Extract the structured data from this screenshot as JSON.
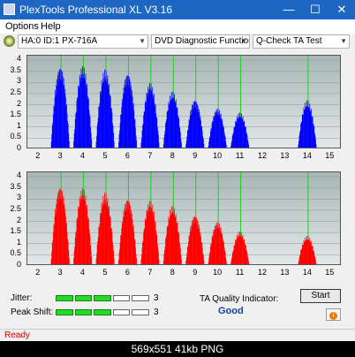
{
  "app": {
    "title": "PlexTools Professional XL V3.16"
  },
  "window_buttons": {
    "minimize": "—",
    "maximize": "☐",
    "close": "✕"
  },
  "menu": {
    "items": [
      {
        "label": "Options"
      },
      {
        "label": "Help"
      }
    ]
  },
  "toolbar": {
    "drive": "HA:0 ID:1  PX-716A",
    "function": "DVD Diagnostic Functions",
    "test": "Q-Check TA Test"
  },
  "chart_data": [
    {
      "type": "bar",
      "colour": "#0000ff",
      "xlim": [
        1.5,
        15.5
      ],
      "ylim": [
        0,
        4.2
      ],
      "yticks": [
        "4",
        "3.5",
        "3",
        "2.5",
        "2",
        "1.5",
        "1",
        "0.5",
        "0"
      ],
      "xticks": [
        "2",
        "3",
        "4",
        "5",
        "6",
        "7",
        "8",
        "9",
        "10",
        "11",
        "12",
        "13",
        "14",
        "15"
      ],
      "green_lines": [
        3,
        4,
        5,
        6,
        7,
        8,
        9,
        10,
        11,
        14
      ],
      "peaks": [
        {
          "center": 2.95,
          "height": 3.75
        },
        {
          "center": 3.95,
          "height": 3.75
        },
        {
          "center": 4.95,
          "height": 3.6
        },
        {
          "center": 5.95,
          "height": 3.45
        },
        {
          "center": 6.95,
          "height": 3.0
        },
        {
          "center": 7.95,
          "height": 2.6
        },
        {
          "center": 8.95,
          "height": 2.25
        },
        {
          "center": 9.95,
          "height": 1.85
        },
        {
          "center": 10.95,
          "height": 1.65
        },
        {
          "center": 13.95,
          "height": 2.2
        }
      ]
    },
    {
      "type": "bar",
      "colour": "#ff0000",
      "xlim": [
        1.5,
        15.5
      ],
      "ylim": [
        0,
        4.2
      ],
      "yticks": [
        "4",
        "3.5",
        "3",
        "2.5",
        "2",
        "1.5",
        "1",
        "0.5",
        "0"
      ],
      "xticks": [
        "2",
        "3",
        "4",
        "5",
        "6",
        "7",
        "8",
        "9",
        "10",
        "11",
        "12",
        "13",
        "14",
        "15"
      ],
      "green_lines": [
        3,
        4,
        5,
        6,
        7,
        8,
        9,
        10,
        11,
        14
      ],
      "peaks": [
        {
          "center": 2.95,
          "height": 3.6
        },
        {
          "center": 3.95,
          "height": 3.5
        },
        {
          "center": 4.95,
          "height": 3.3
        },
        {
          "center": 5.95,
          "height": 3.05
        },
        {
          "center": 6.95,
          "height": 2.95
        },
        {
          "center": 7.95,
          "height": 2.7
        },
        {
          "center": 8.95,
          "height": 2.3
        },
        {
          "center": 9.95,
          "height": 2.0
        },
        {
          "center": 10.95,
          "height": 1.55
        },
        {
          "center": 13.95,
          "height": 1.35
        }
      ]
    }
  ],
  "metrics": {
    "jitter": {
      "label": "Jitter:",
      "value": "3",
      "segments_on": 3,
      "segments_total": 5
    },
    "peak_shift": {
      "label": "Peak Shift:",
      "value": "3",
      "segments_on": 3,
      "segments_total": 5
    }
  },
  "ta_quality": {
    "label": "TA Quality Indicator:",
    "value": "Good"
  },
  "buttons": {
    "start": "Start",
    "info": "i"
  },
  "status": {
    "text": "Ready"
  },
  "caption": "569x551  41kb  PNG"
}
